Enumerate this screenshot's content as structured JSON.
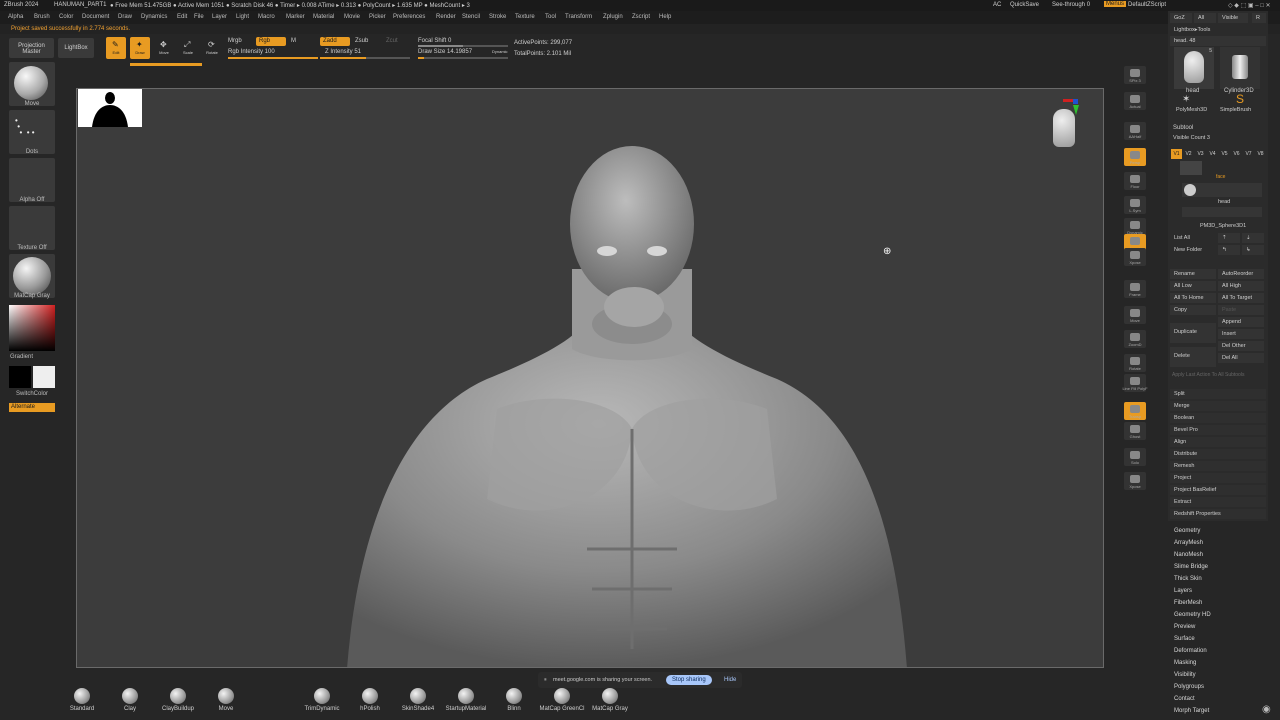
{
  "app": {
    "title_items": [
      "ZBrush 2024",
      "HANUMAN_PART1",
      "● Free Mem 51.475GB ● Active Mem 1051 ● Scratch Disk 46 ● Timer ▸ 0.008 ATime ▸ 0.313 ● PolyCount ▸ 1.635 MP ● MeshCount ▸ 3"
    ],
    "title_right": [
      "AC",
      "QuickSave",
      "See-through 0",
      "Menus",
      "DefaultZScript"
    ]
  },
  "menubar": [
    "Alpha",
    "Brush",
    "Color",
    "Document",
    "Draw",
    "Dynamics",
    "Edit",
    "File",
    "Layer",
    "Light",
    "Macro",
    "Marker",
    "Material",
    "Movie",
    "Picker",
    "Preferences",
    "Render",
    "Stencil",
    "Stroke",
    "Texture",
    "Tool",
    "Transform",
    "Zplugin",
    "Zscript",
    "Help"
  ],
  "status_message": "Project saved successfully in 2.774 seconds.",
  "shelf": {
    "projection_master": "Projection Master",
    "lightbox": "LightBox",
    "edit": "Edit",
    "draw": "Draw",
    "move": "Move",
    "scale": "Scale",
    "rotate": "Rotate",
    "mrgb": "Mrgb",
    "rgb": "Rgb",
    "m": "M",
    "rgb_intensity": "Rgb Intensity 100",
    "zadd": "Zadd",
    "zsub": "Zsub",
    "zcut": "Zcut",
    "z_intensity": "Z Intensity 51",
    "focal_shift": "Focal Shift 0",
    "draw_size": "Draw Size 14.19857",
    "dynamic": "Dynamic",
    "active_points": "ActivePoints: 299,077",
    "total_points": "TotalPoints: 2.101 Mil",
    "rgb_intensity_value": 100,
    "z_intensity_value": 51,
    "draw_size_value": 14.19857
  },
  "left_tray": {
    "items": [
      "Move",
      "Dots",
      "Alpha Off",
      "Texture Off",
      "MatCap Gray"
    ],
    "gradient": "Gradient",
    "switch_color": "SwitchColor",
    "alternate": "Alternate"
  },
  "right_strip": [
    "SPix 3",
    "Actual",
    "AAHalf",
    "Persp",
    "Floor",
    "L.Sym",
    "Dynamic",
    "Local",
    "Xpose",
    "Frame",
    "Move",
    "ZoomD",
    "Rotate",
    "Line Fill PolyF",
    "Transp",
    "Ghost",
    "Solo",
    "Xpose"
  ],
  "tool_panel": {
    "goz": "GoZ",
    "all": "All",
    "visible": "Visible",
    "r": "R",
    "lightbox_tools": "Lightbox▸Tools",
    "head_slider": "head. 48",
    "tools": [
      "head",
      "Cylinder3D",
      "PolyMesh3D",
      "SimpleBrush"
    ],
    "tool_badge_num": "5",
    "subtool_title": "Subtool",
    "visible_count": "Visible Count 3",
    "v_tabs": [
      "V1",
      "V2",
      "V3",
      "V4",
      "V5",
      "V6",
      "V7",
      "V8"
    ],
    "subtools": [
      "face",
      "head",
      "PM3D_Sphere3D1"
    ],
    "list_all": "List All",
    "new_folder": "New Folder",
    "buttons_left": [
      "Rename",
      "All Low",
      "All To Home",
      "Copy",
      "Duplicate",
      "Delete"
    ],
    "buttons_right": [
      "AutoReorder",
      "All High",
      "All To Target",
      "Paste",
      "Append",
      "Insert",
      "Del Other",
      "Del All"
    ],
    "apply_last": "Apply Last Action To All Subtools",
    "actions": [
      "Split",
      "Merge",
      "Boolean",
      "Bevel Pro",
      "Align",
      "Distribute",
      "Remesh",
      "Project",
      "Project BasRelief",
      "Extract",
      "Redshift Properties"
    ],
    "sections": [
      "Geometry",
      "ArrayMesh",
      "NanoMesh",
      "Slime Bridge",
      "Thick Skin",
      "Layers",
      "FiberMesh",
      "Geometry HD",
      "Preview",
      "Surface",
      "Deformation",
      "Masking",
      "Visibility",
      "Polygroups",
      "Contact",
      "Morph Target"
    ]
  },
  "bottom_brushes": [
    "Standard",
    "Clay",
    "ClayBuildup",
    "Move",
    "TrimDynamic",
    "hPolish",
    "SkinShade4",
    "StartupMaterial",
    "Blinn",
    "MatCap GreenCl",
    "MatCap Gray"
  ],
  "screen_share": {
    "message": "meet.google.com is sharing your screen.",
    "stop": "Stop sharing",
    "hide": "Hide"
  },
  "colors": {
    "accent": "#e89b22",
    "canvas": "#3c3c3c",
    "background": "#262626"
  }
}
